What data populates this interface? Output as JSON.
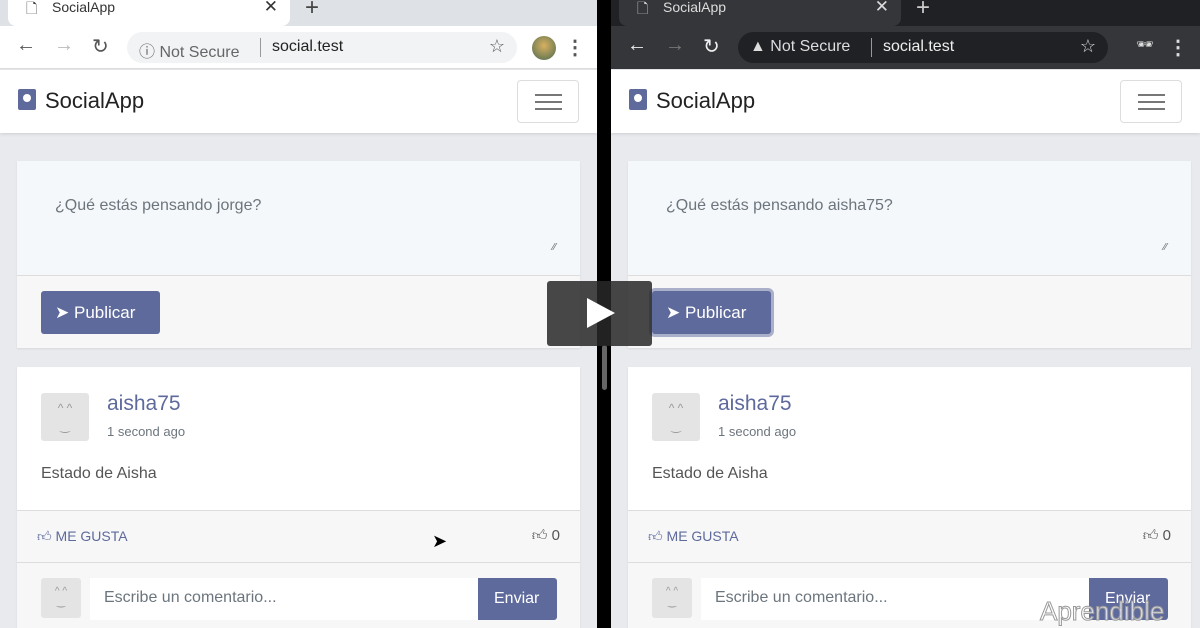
{
  "panes": [
    {
      "tab_title": "SocialApp",
      "security": "ⓘ Not Secure",
      "url": "social.test",
      "brand": "SocialApp",
      "placeholder": "¿Qué estás pensando jorge?",
      "publish": "Publicar",
      "post": {
        "author": "aisha75",
        "time": "1 second ago",
        "text": "Estado de Aisha",
        "like_label": "ME GUSTA",
        "likes": "0"
      },
      "comment_placeholder": "Escribe un comentario...",
      "send": "Enviar"
    },
    {
      "tab_title": "SocialApp",
      "security": "▲ Not Secure",
      "url": "social.test",
      "brand": "SocialApp",
      "placeholder": "¿Qué estás pensando aisha75?",
      "publish": "Publicar",
      "post": {
        "author": "aisha75",
        "time": "1 second ago",
        "text": "Estado de Aisha",
        "like_label": "ME GUSTA",
        "likes": "0"
      },
      "comment_placeholder": "Escribe un comentario...",
      "send": "Enviar"
    }
  ],
  "watermark": "Aprendible",
  "colors": {
    "accent": "#5e6a9c",
    "page_bg": "#e9eaee"
  }
}
